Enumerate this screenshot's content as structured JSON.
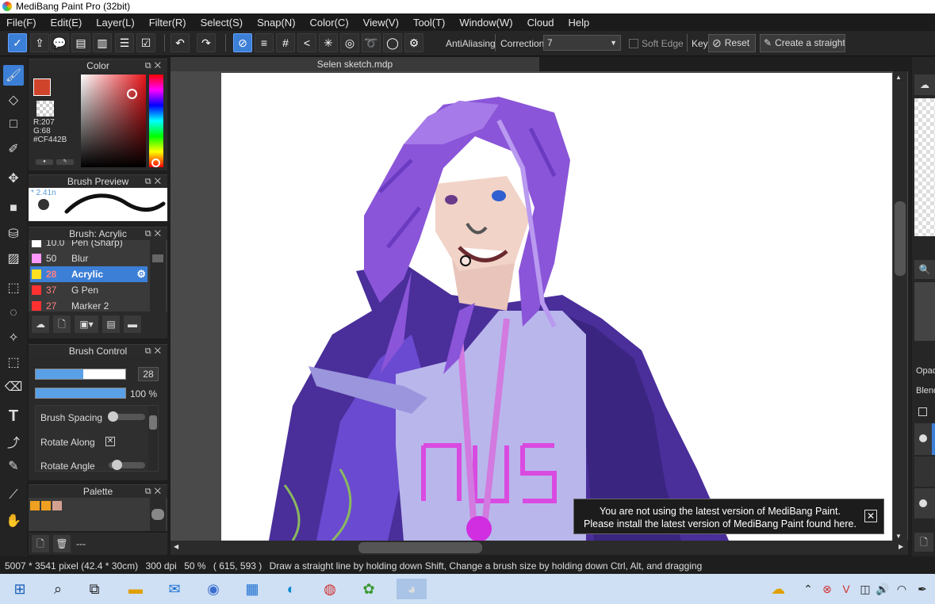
{
  "app": {
    "title": "MediBang Paint Pro (32bit)"
  },
  "menu": [
    "File(F)",
    "Edit(E)",
    "Layer(L)",
    "Filter(R)",
    "Select(S)",
    "Snap(N)",
    "Color(C)",
    "View(V)",
    "Tool(T)",
    "Window(W)",
    "Cloud",
    "Help"
  ],
  "toolbar": {
    "antialiasing_label": "AntiAliasing",
    "correction_label": "Correction",
    "correction_value": "7",
    "soft_edge_label": "Soft Edge",
    "key_label": "Key",
    "reset_label": "Reset",
    "create_straight_label": "Create a straight"
  },
  "color_panel": {
    "title": "Color",
    "r": "R:207",
    "g": "G:68",
    "hex": "#CF442B",
    "primary_color": "#CF442B"
  },
  "brush_preview": {
    "title": "Brush Preview",
    "size": "2.41n"
  },
  "brush_panel": {
    "title": "Brush: Acrylic",
    "items": [
      {
        "num": "10.0",
        "name": "Pen (Sharp)",
        "color": "#ffffff"
      },
      {
        "num": "50",
        "name": "Blur",
        "color": "#ff99ff"
      },
      {
        "num": "28",
        "name": "Acrylic",
        "color": "#ffe020",
        "selected": true
      },
      {
        "num": "37",
        "name": "G Pen",
        "color": "#ff3030"
      },
      {
        "num": "27",
        "name": "Marker 2",
        "color": "#ff3030"
      }
    ]
  },
  "brush_control": {
    "title": "Brush Control",
    "size_value": "28",
    "size_fraction": 0.53,
    "opacity_value": "100 %",
    "opacity_fraction": 1.0,
    "spacing_label": "Brush Spacing",
    "rotate_along_label": "Rotate Along",
    "rotate_angle_label": "Rotate Angle"
  },
  "palette": {
    "title": "Palette",
    "swatches": [
      "#f0a020",
      "#f0a020",
      "#d4a090"
    ],
    "footer_text": "---"
  },
  "document": {
    "tab": "Selen sketch.mdp"
  },
  "notification": {
    "line1": "You are not using the latest version of MediBang Paint.",
    "line2": "Please install the latest version of MediBang Paint found here."
  },
  "right_panel": {
    "opacity_label": "Opac",
    "blend_label": "Blend"
  },
  "status": {
    "size": "5007 * 3541 pixel",
    "physical": "(42.4 * 30cm)",
    "dpi": "300 dpi",
    "zoom": "50 %",
    "coords": "( 615, 593 )",
    "hint": "Draw a straight line by holding down Shift, Change a brush size by holding down Ctrl, Alt, and dragging"
  }
}
